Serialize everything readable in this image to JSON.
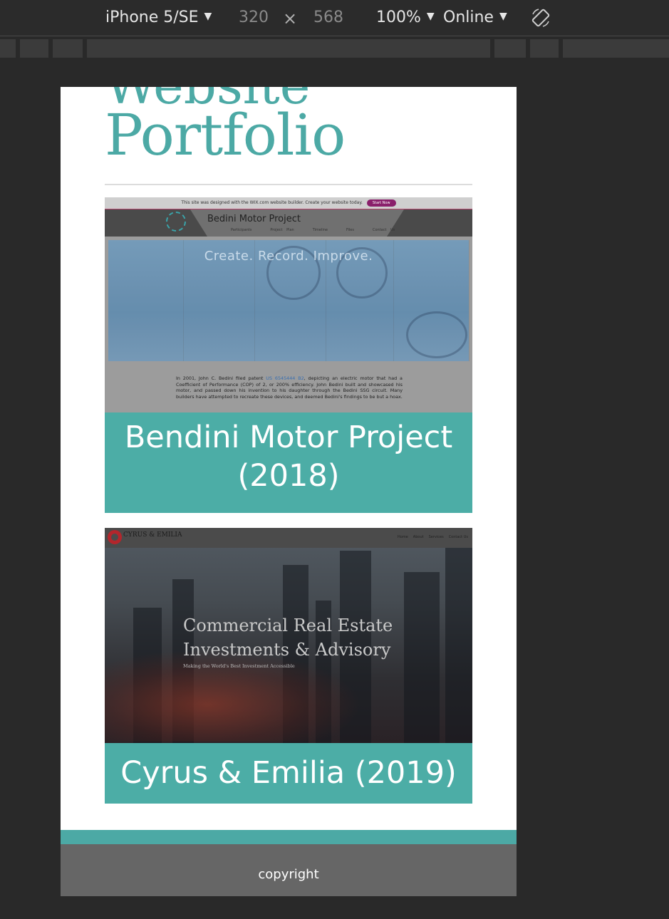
{
  "devtools": {
    "device": "iPhone 5/SE",
    "width": "320",
    "height": "568",
    "times": "×",
    "zoom": "100%",
    "throttling": "Online"
  },
  "page": {
    "title_partial": "Website",
    "title": "Portfolio"
  },
  "projects": [
    {
      "caption": "Bendini Motor Project (2018)",
      "screenshot": {
        "wix_banner": "This site was designed with the WIX.com website builder. Create your website today.",
        "wix_button": "Start Now",
        "site_name": "Bedini Motor Project",
        "nav": [
          "Participants",
          "Project Plan",
          "Timeline",
          "Files",
          "Contact Us"
        ],
        "tagline": "Create. Record. Improve.",
        "body_before_link": "In 2001, John C. Bedini filed patent ",
        "body_link": "US 6545444 B2",
        "body_after_link": ", depicting an electric motor that had a Coefficient of Performance (COP) of 2, or 200% efficiency. John Bedini built and showcased his motor, and passed down his invention to his daughter through the Bedini SSG circuit. Many builders have attempted to recreate these devices, and deemed Bedini's findings to be but a hoax."
      }
    },
    {
      "caption": "Cyrus & Emilia (2019)",
      "screenshot": {
        "brand": "CYRUS & EMILIA",
        "nav": [
          "Home",
          "About",
          "Services",
          "Contact Us"
        ],
        "headline_line1": "Commercial Real Estate",
        "headline_line2": "Investments & Advisory",
        "subheadline": "Making the World's Best Investment Accessible"
      }
    }
  ],
  "footer": {
    "text": "copyright"
  },
  "colors": {
    "accent": "#4ca9a5",
    "footer_bg": "#666666",
    "devtools_bg": "#292929"
  }
}
